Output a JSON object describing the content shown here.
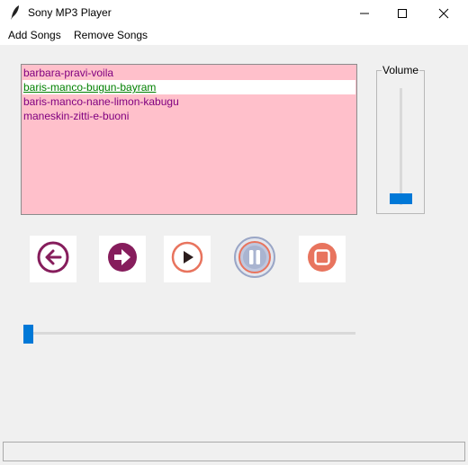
{
  "window": {
    "title": "Sony MP3 Player"
  },
  "menu": {
    "add_songs": "Add Songs",
    "remove_songs": "Remove Songs"
  },
  "playlist": {
    "songs": [
      "barbara-pravi-voila",
      "baris-manco-bugun-bayram",
      "baris-manco-nane-limon-kabugu",
      "maneskin-zitti-e-buoni"
    ],
    "selected_index": 1,
    "background": "#ffc0cb",
    "text_color": "#800080",
    "selected_text_color": "#008000"
  },
  "volume": {
    "label": "Volume",
    "level": 0.1
  },
  "controls": [
    {
      "name": "back-icon"
    },
    {
      "name": "forward-icon"
    },
    {
      "name": "play-icon"
    },
    {
      "name": "pause-icon"
    },
    {
      "name": "stop-icon"
    }
  ],
  "seek": {
    "position": 0
  },
  "status": {
    "text": ""
  },
  "colors": {
    "accent": "#0078d7",
    "dark_purple": "#861d5c",
    "coral": "#e8745e"
  }
}
